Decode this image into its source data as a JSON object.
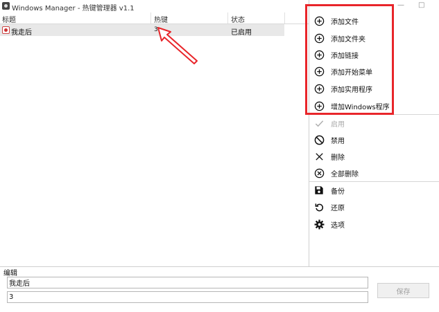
{
  "window": {
    "title": "Windows Manager - 热键管理器 v1.1",
    "minimize_glyph": "—",
    "maximize_glyph": "□"
  },
  "table": {
    "columns": [
      "标题",
      "热键",
      "状态"
    ],
    "rows": [
      {
        "title": "我走后",
        "hotkey": "3",
        "status": "已启用",
        "selected": true
      }
    ]
  },
  "menu": {
    "items": [
      {
        "label": "添加文件",
        "icon": "plus-circle-icon",
        "enabled": true
      },
      {
        "label": "添加文件夹",
        "icon": "plus-circle-icon",
        "enabled": true
      },
      {
        "label": "添加链接",
        "icon": "plus-circle-icon",
        "enabled": true
      },
      {
        "label": "添加开始菜单",
        "icon": "plus-circle-icon",
        "enabled": true
      },
      {
        "label": "添加实用程序",
        "icon": "plus-circle-icon",
        "enabled": true
      },
      {
        "label": "增加Windows程序",
        "icon": "plus-circle-icon",
        "enabled": true
      },
      {
        "label": "启用",
        "icon": "check-icon",
        "enabled": false
      },
      {
        "label": "禁用",
        "icon": "ban-icon",
        "enabled": true
      },
      {
        "label": "删除",
        "icon": "x-icon",
        "enabled": true
      },
      {
        "label": "全部删除",
        "icon": "x-circle-icon",
        "enabled": true
      },
      {
        "label": "备份",
        "icon": "save-icon",
        "enabled": true
      },
      {
        "label": "还原",
        "icon": "restore-icon",
        "enabled": true
      },
      {
        "label": "选项",
        "icon": "gear-icon",
        "enabled": true
      }
    ]
  },
  "edit": {
    "label": "编辑",
    "title_value": "我走后",
    "hotkey_value": "3",
    "save_label": "保存"
  },
  "colors": {
    "highlight": "#e8252a",
    "selected_row": "#e8e8e8"
  }
}
